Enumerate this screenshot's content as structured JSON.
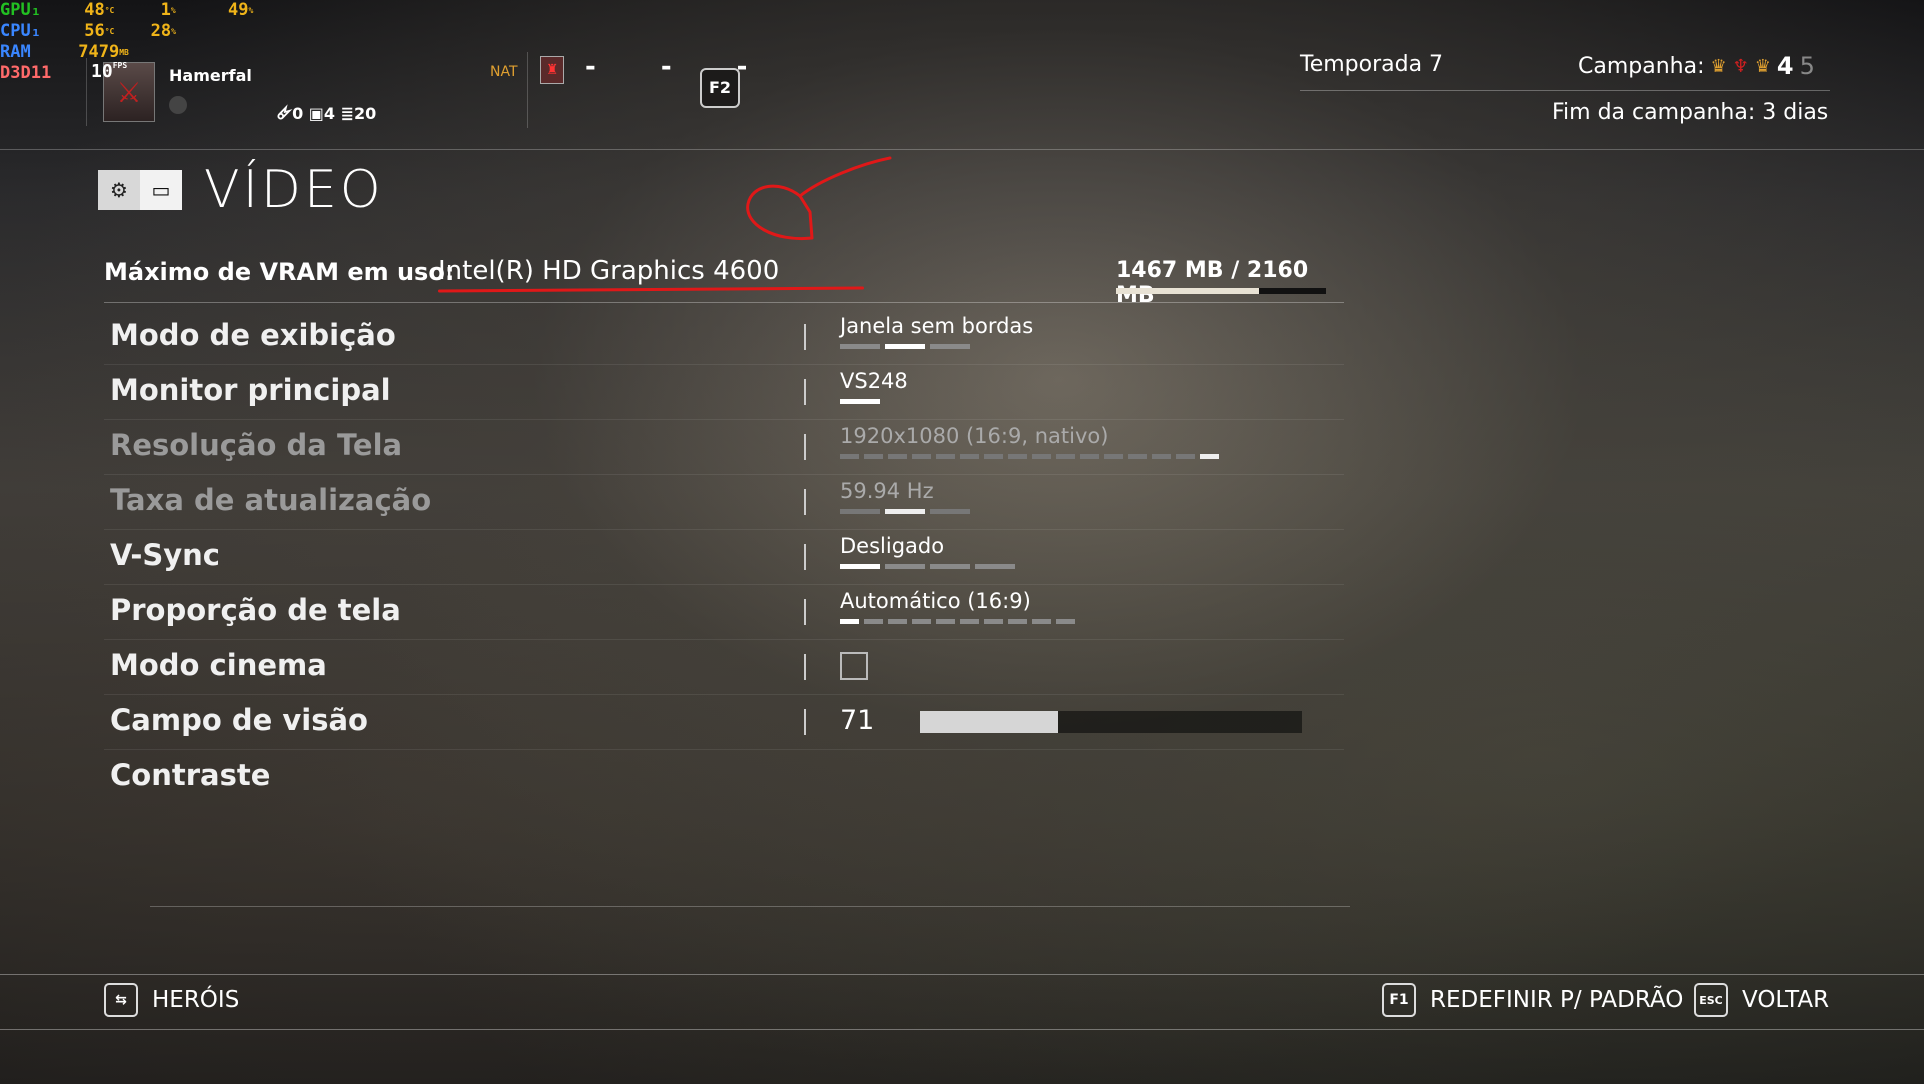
{
  "overlay": {
    "gpu": {
      "label": "GPU₁",
      "temp": "48",
      "temp_unit": "°C",
      "load": "1",
      "load_unit": "%",
      "extra": "49",
      "extra_unit": "%"
    },
    "cpu": {
      "label": "CPU₁",
      "temp": "56",
      "temp_unit": "°C",
      "load": "28",
      "load_unit": "%"
    },
    "ram": {
      "label": "RAM",
      "value": "7479",
      "unit": "MB"
    },
    "api": {
      "label": "D3D11",
      "fps": "10",
      "fps_unit": "FPS"
    }
  },
  "player": {
    "name": "Hamerfal",
    "stats": "🜸0 ▣4 ≣20",
    "nat_label": "NAT",
    "slots": "- - -",
    "f2_key": "F2"
  },
  "season": {
    "label": "Temporada 7",
    "campaign_label": "Campanha:",
    "campaign_current": "4",
    "campaign_next": "5",
    "campaign_end": "Fim da campanha: 3 dias"
  },
  "page": {
    "title": "VÍDEO",
    "icons": [
      "gear-icon",
      "monitor-icon"
    ]
  },
  "vram": {
    "label": "Máximo de VRAM em uso:",
    "gpu": "Intel(R) HD Graphics 4600",
    "amount": "1467 MB / 2160 MB",
    "used_mb": 1467,
    "total_mb": 2160
  },
  "settings": [
    {
      "label": "Modo de exibição",
      "value": "Janela sem bordas",
      "ticks": 3,
      "selected": 2,
      "disabled": false
    },
    {
      "label": "Monitor principal",
      "value": "VS248",
      "ticks": 1,
      "selected": 1,
      "disabled": false
    },
    {
      "label": "Resolução da Tela",
      "value": "1920x1080 (16:9, nativo)",
      "ticks": 16,
      "selected": 16,
      "disabled": true
    },
    {
      "label": "Taxa de atualização",
      "value": "59.94 Hz",
      "ticks": 3,
      "selected": 2,
      "disabled": true
    },
    {
      "label": "V-Sync",
      "value": "Desligado",
      "ticks": 4,
      "selected": 1,
      "disabled": false
    },
    {
      "label": "Proporção de tela",
      "value": "Automático (16:9)",
      "ticks": 10,
      "selected": 1,
      "disabled": false
    },
    {
      "label": "Modo cinema",
      "checked": false
    },
    {
      "label": "Campo de visão",
      "value": "71",
      "fill_fraction": 0.36
    },
    {
      "label": "Contraste"
    }
  ],
  "footer": {
    "heroes_label": "HERÓIS",
    "reset_key": "F1",
    "reset_label": "REDEFINIR P/ PADRÃO",
    "back_key": "ESC",
    "back_label": "VOLTAR"
  },
  "colors": {
    "overlay_value": "#f0b419",
    "overlay_gpu": "#22c022",
    "overlay_cpu": "#3a86ff",
    "overlay_api": "#ff6a6a",
    "annotation": "#e01818"
  }
}
